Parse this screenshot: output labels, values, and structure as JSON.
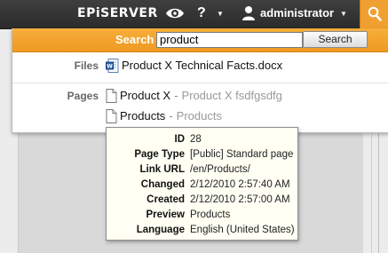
{
  "topbar": {
    "logo": "EPiSERVER",
    "help_label": "?",
    "username": "administrator"
  },
  "search": {
    "label": "Search",
    "value": "product",
    "button_label": "Search"
  },
  "sections": {
    "files_label": "Files",
    "pages_label": "Pages"
  },
  "files": [
    {
      "title": "Product X Technical Facts.docx",
      "icon": "word-document-icon"
    }
  ],
  "pages": [
    {
      "title": "Product X",
      "separator": "-",
      "path": "Product X fsdfgsdfg",
      "icon": "page-icon"
    },
    {
      "title": "Products",
      "separator": "-",
      "path": "Products",
      "icon": "page-icon"
    }
  ],
  "tooltip": {
    "rows": [
      {
        "key": "ID",
        "value": "28"
      },
      {
        "key": "Page Type",
        "value": "[Public] Standard page"
      },
      {
        "key": "Link URL",
        "value": "/en/Products/"
      },
      {
        "key": "Changed",
        "value": "2/12/2010 2:57:40 AM"
      },
      {
        "key": "Created",
        "value": "2/12/2010 2:57:00 AM"
      },
      {
        "key": "Preview",
        "value": "Products"
      },
      {
        "key": "Language",
        "value": "English (United States)"
      }
    ]
  },
  "colors": {
    "topbar": "#333333",
    "accent_orange": "#f0a030",
    "tooltip_bg": "#fffff4"
  }
}
